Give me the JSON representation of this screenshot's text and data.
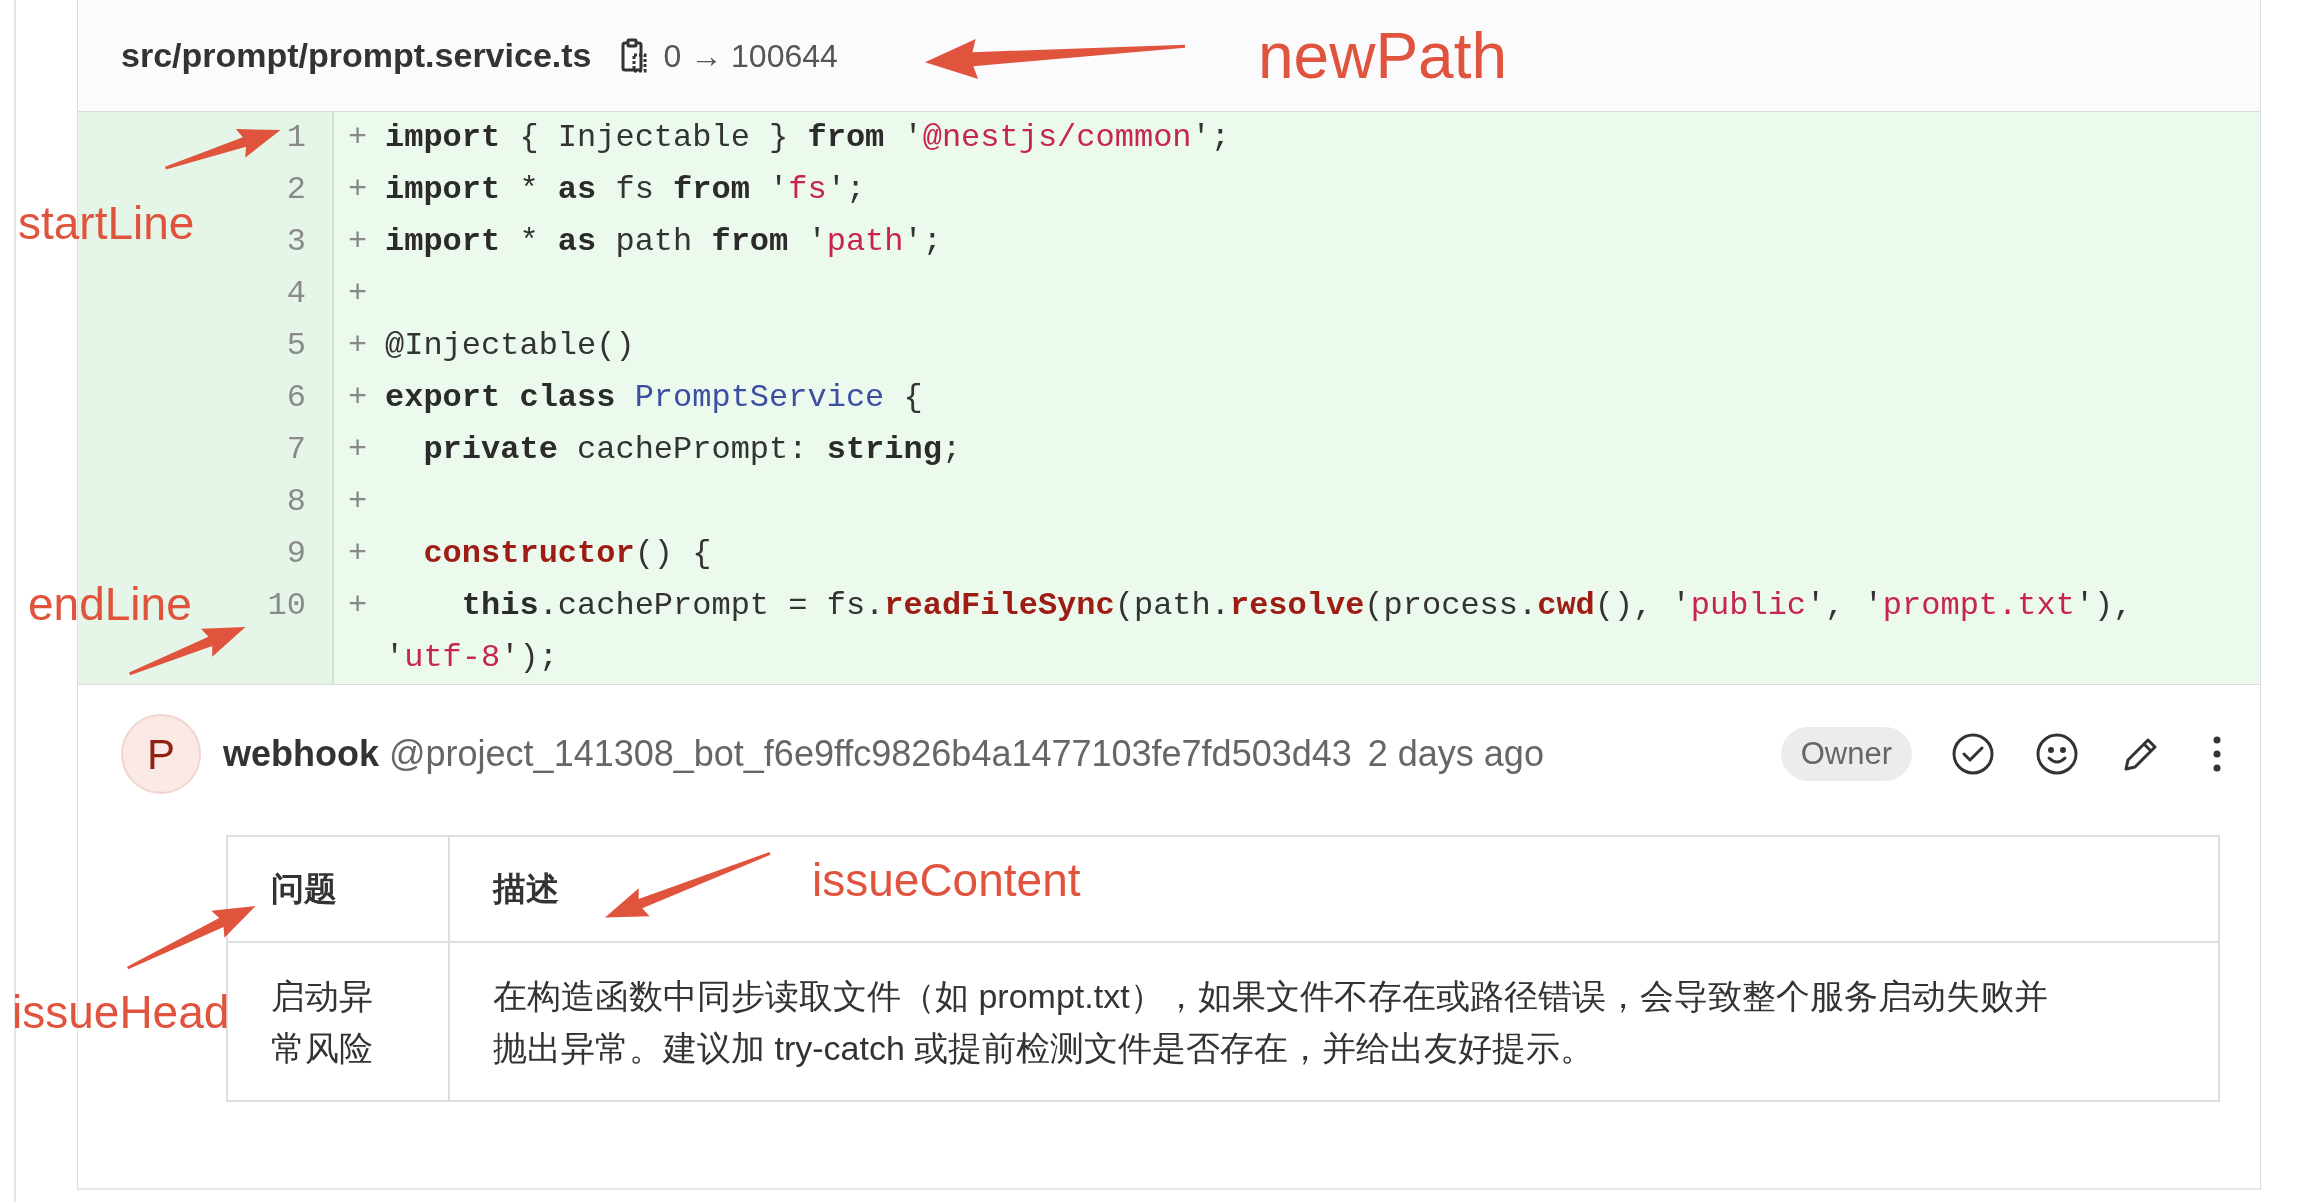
{
  "file": {
    "path": "src/prompt/prompt.service.ts",
    "mode_change": "0 → 100644"
  },
  "diff_lines": [
    {
      "number": "1",
      "marker": "+",
      "tokens": [
        {
          "text": "import",
          "kind": "kw"
        },
        {
          "text": " { Injectable } ",
          "kind": "plain"
        },
        {
          "text": "from",
          "kind": "kw"
        },
        {
          "text": " '",
          "kind": "plain"
        },
        {
          "text": "@nestjs/common",
          "kind": "str"
        },
        {
          "text": "';",
          "kind": "plain"
        }
      ]
    },
    {
      "number": "2",
      "marker": "+",
      "tokens": [
        {
          "text": "import",
          "kind": "kw"
        },
        {
          "text": " * ",
          "kind": "plain"
        },
        {
          "text": "as",
          "kind": "kw"
        },
        {
          "text": " fs ",
          "kind": "plain"
        },
        {
          "text": "from",
          "kind": "kw"
        },
        {
          "text": " '",
          "kind": "plain"
        },
        {
          "text": "fs",
          "kind": "str"
        },
        {
          "text": "';",
          "kind": "plain"
        }
      ]
    },
    {
      "number": "3",
      "marker": "+",
      "tokens": [
        {
          "text": "import",
          "kind": "kw"
        },
        {
          "text": " * ",
          "kind": "plain"
        },
        {
          "text": "as",
          "kind": "kw"
        },
        {
          "text": " path ",
          "kind": "plain"
        },
        {
          "text": "from",
          "kind": "kw"
        },
        {
          "text": " '",
          "kind": "plain"
        },
        {
          "text": "path",
          "kind": "str"
        },
        {
          "text": "';",
          "kind": "plain"
        }
      ]
    },
    {
      "number": "4",
      "marker": "+"
    },
    {
      "number": "5",
      "marker": "+",
      "tokens": [
        {
          "text": "@Injectable()",
          "kind": "plain"
        }
      ]
    },
    {
      "number": "6",
      "marker": "+",
      "tokens": [
        {
          "text": "export",
          "kind": "kw"
        },
        {
          "text": " class",
          "kind": "kw"
        },
        {
          "text": " PromptService",
          "kind": "cls"
        },
        {
          "text": " {",
          "kind": "plain"
        }
      ]
    },
    {
      "number": "7",
      "marker": "+",
      "tokens": [
        {
          "text": "  private",
          "kind": "kw"
        },
        {
          "text": " cachePrompt: ",
          "kind": "plain"
        },
        {
          "text": "string",
          "kind": "kw"
        },
        {
          "text": ";",
          "kind": "plain"
        }
      ]
    },
    {
      "number": "8",
      "marker": "+"
    },
    {
      "number": "9",
      "marker": "+",
      "tokens": [
        {
          "text": "  constructor",
          "kind": "fn"
        },
        {
          "text": "() {",
          "kind": "plain"
        }
      ]
    },
    {
      "number": "10",
      "marker": "+",
      "tokens": [
        {
          "text": "    this",
          "kind": "kw"
        },
        {
          "text": ".cachePrompt = fs.",
          "kind": "plain"
        },
        {
          "text": "readFileSync",
          "kind": "fn"
        },
        {
          "text": "(path.",
          "kind": "plain"
        },
        {
          "text": "resolve",
          "kind": "fn"
        },
        {
          "text": "(process.",
          "kind": "plain"
        },
        {
          "text": "cwd",
          "kind": "fn"
        },
        {
          "text": "(), '",
          "kind": "plain"
        },
        {
          "text": "public",
          "kind": "str"
        },
        {
          "text": "', '",
          "kind": "plain"
        },
        {
          "text": "prompt.txt",
          "kind": "str"
        },
        {
          "text": "'), '",
          "kind": "plain"
        },
        {
          "text": "utf-8",
          "kind": "str"
        },
        {
          "text": "');",
          "kind": "plain"
        }
      ]
    }
  ],
  "comment": {
    "avatar_letter": "P",
    "author": "webhook",
    "handle": "@project_141308_bot_f6e9ffc9826b4a1477103fe7fd503d43",
    "time": "2 days ago",
    "role_badge": "Owner",
    "table": {
      "columns": [
        "问题",
        "描述"
      ],
      "rows": [
        [
          "启动异常风险",
          "在构造函数中同步读取文件（如 prompt.txt），如果文件不存在或路径错误，会导致整个服务启动失败并抛出异常。建议加 try-catch 或提前检测文件是否存在，并给出友好提示。"
        ]
      ]
    }
  },
  "annotations": [
    {
      "text": "newPath"
    },
    {
      "text": "startLine"
    },
    {
      "text": "endLine"
    },
    {
      "text": "issueContent"
    },
    {
      "text": "issueHead"
    }
  ]
}
